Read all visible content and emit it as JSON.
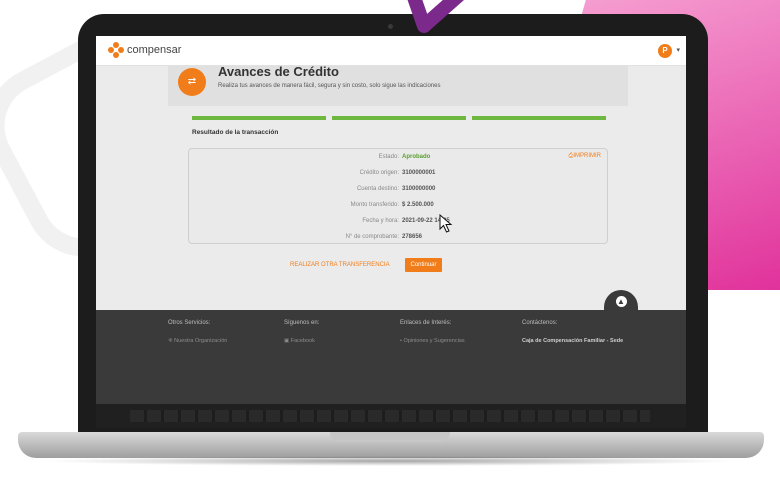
{
  "app": {
    "logo_text": "compensar",
    "avatar_initial": "P"
  },
  "banner": {
    "title": "Avances de Crédito",
    "subtitle": "Realiza tus avances de manera fácil, segura y sin costo, solo sigue las indicaciones"
  },
  "result": {
    "section_title": "Resultado de la transacción",
    "print_label": "IMPRIMIR",
    "rows": [
      {
        "label": "Estado:",
        "value": "Aprobado"
      },
      {
        "label": "Crédito origen:",
        "value": "3100000001"
      },
      {
        "label": "Cuenta destino:",
        "value": "3100000000"
      },
      {
        "label": "Monto transferido:",
        "value": "$ 2.500.000"
      },
      {
        "label": "Fecha y hora:",
        "value": "2021-09-22 14:25"
      },
      {
        "label": "N° de comprobante:",
        "value": "278656"
      }
    ]
  },
  "actions": {
    "other_transfer": "REALIZAR OTRA TRANSFERENCIA",
    "continue": "Continuar"
  },
  "footer": {
    "columns": [
      {
        "heading": "Otros Servicios:",
        "item": "Nuestra Organización"
      },
      {
        "heading": "Síguenos en:",
        "item": "Facebook"
      },
      {
        "heading": "Enlaces de Interés:",
        "item": "Opiniones y Sugerencias"
      },
      {
        "heading": "Contáctenos:",
        "item": "Caja de Compensación Familiar - Sede"
      }
    ]
  },
  "colors": {
    "accent": "#f07d1a",
    "success": "#5a9e2f",
    "pink": "#e0309a",
    "purple": "#7b2a8c"
  }
}
